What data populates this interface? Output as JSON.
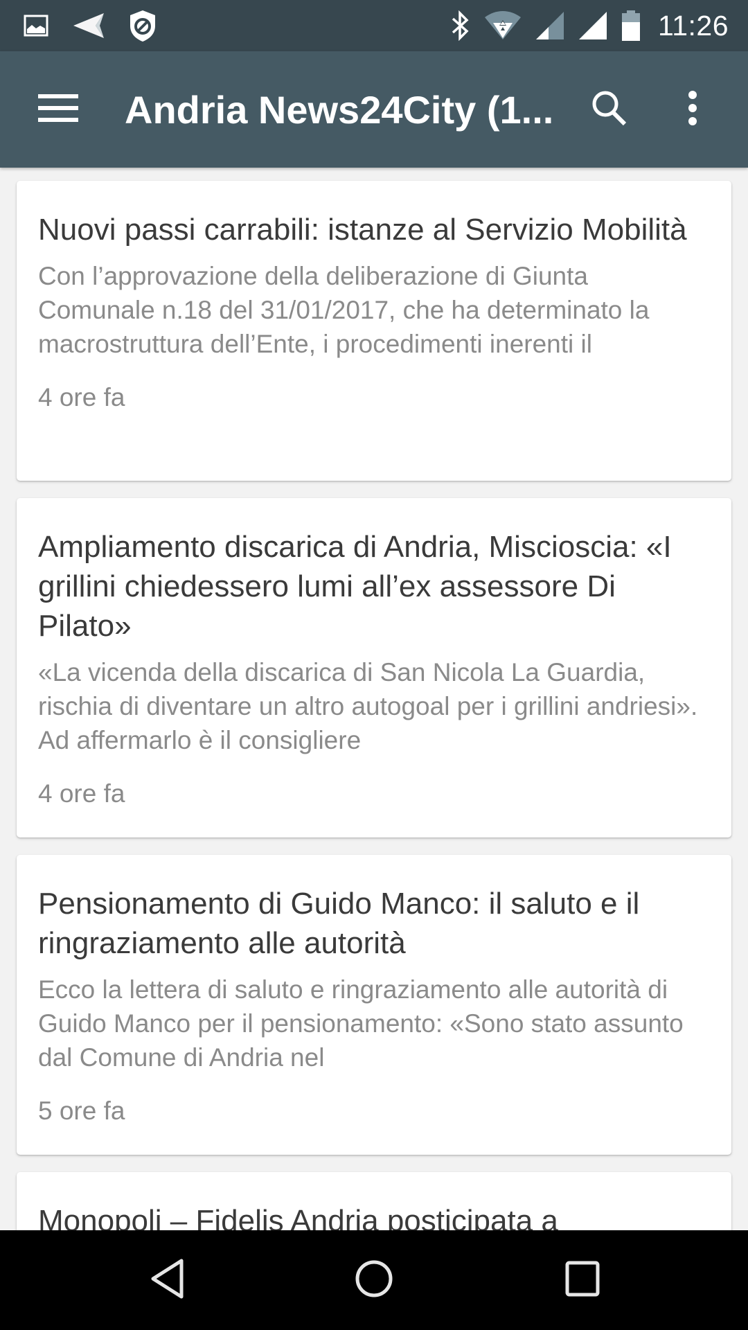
{
  "status_bar": {
    "left_icons": [
      "image-notification-icon",
      "send-notification-icon",
      "shield-blocked-icon"
    ],
    "right_icons": [
      "bluetooth-icon",
      "wifi-icon",
      "cell-signal-1-icon",
      "cell-signal-2-icon",
      "battery-icon"
    ],
    "time": "11:26"
  },
  "app_bar": {
    "title": "Andria News24City (1...",
    "menu_icon": "hamburger-menu-icon",
    "search_icon": "search-icon",
    "more_icon": "more-vert-icon"
  },
  "articles": [
    {
      "title": "Nuovi passi carrabili: istanze al Servizio Mobilità",
      "summary": "Con l’approvazione della deliberazione di Giunta Comunale n.18 del 31/01/2017, che ha determinato la macrostruttura dell’Ente, i procedimenti inerenti il",
      "time": "4 ore fa"
    },
    {
      "title": "Ampliamento discarica di Andria, Miscioscia: «I grillini chiedessero lumi all’ex assessore Di Pilato»",
      "summary": "«La vicenda della discarica di San Nicola La Guardia, rischia di diventare un altro autogoal per i grillini andriesi». Ad affermarlo è il consigliere",
      "time": "4 ore fa"
    },
    {
      "title": "Pensionamento di Guido Manco: il saluto e il ringraziamento alle autorità",
      "summary": "Ecco la lettera di saluto e ringraziamento alle autorità di Guido Manco per il pensionamento: «Sono stato assunto dal Comune di Andria nel",
      "time": "5 ore fa"
    },
    {
      "title": "Monopoli – Fidelis Andria posticipata a",
      "summary": "",
      "time": ""
    }
  ],
  "nav_bar": {
    "back_icon": "back-icon",
    "home_icon": "home-icon",
    "recents_icon": "recents-icon"
  },
  "colors": {
    "status_bar": "#37474f",
    "app_bar": "#455a64",
    "background": "#f2f2f2",
    "card": "#ffffff",
    "title_text": "#3a3a3a",
    "secondary_text": "#8a8a8a"
  }
}
